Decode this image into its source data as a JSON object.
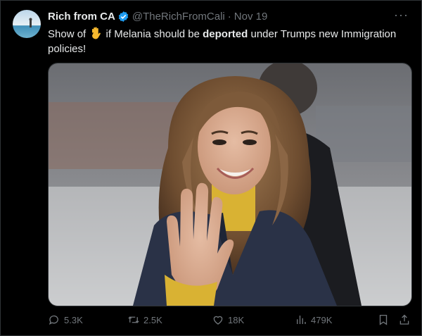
{
  "tweet": {
    "author_name": "Rich from CA",
    "handle": "@TheRichFromCali",
    "separator": "·",
    "date": "Nov 19",
    "text_prefix": "Show of",
    "text_middle": "if Melania should be",
    "text_bold": "deported",
    "text_suffix": "under Trumps new Immigration policies!"
  },
  "icons": {
    "verified": "verified-badge-icon",
    "emoji": "raised-hand-emoji",
    "more": "more-icon",
    "reply": "reply-icon",
    "retweet": "retweet-icon",
    "like": "heart-icon",
    "views": "views-icon",
    "bookmark": "bookmark-icon",
    "share": "share-icon"
  },
  "actions": {
    "replies": "5.3K",
    "retweets": "2.5K",
    "likes": "18K",
    "views": "479K"
  },
  "colors": {
    "background": "#000000",
    "text": "#e7e9ea",
    "secondary": "#71767b",
    "verified": "#1d9bf0"
  }
}
